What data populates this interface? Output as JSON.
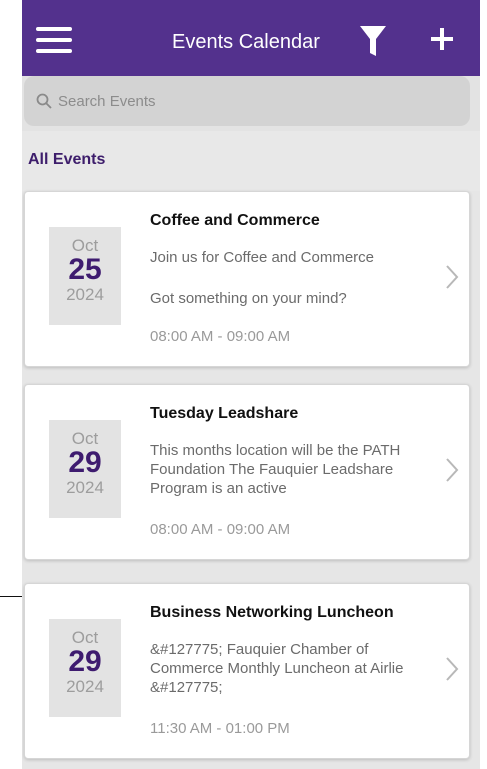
{
  "header": {
    "title": "Events Calendar",
    "menu_icon": "hamburger-menu-icon",
    "filter_icon": "filter-funnel-icon",
    "add_icon": "plus-icon"
  },
  "search": {
    "placeholder": "Search Events",
    "value": ""
  },
  "section": {
    "label": "All Events"
  },
  "colors": {
    "brand": "#53318d",
    "day_text": "#3e1b6f",
    "section_label": "#3d1d6b"
  },
  "events": [
    {
      "month": "Oct",
      "day": "25",
      "year": "2024",
      "title": "Coffee and Commerce",
      "description": "Join us for Coffee and Commerce",
      "description2": "Got something on your mind?",
      "time": "08:00 AM - 09:00 AM"
    },
    {
      "month": "Oct",
      "day": "29",
      "year": "2024",
      "title": "Tuesday Leadshare",
      "description": "This months location will be the PATH Foundation  The Fauquier Leadshare Program is an active",
      "time": "08:00 AM - 09:00 AM"
    },
    {
      "month": "Oct",
      "day": "29",
      "year": "2024",
      "title": "Business Networking Luncheon",
      "description": "&#127775; Fauquier Chamber of Commerce Monthly Luncheon at Airlie &#127775;",
      "time": "11:30 AM - 01:00 PM"
    }
  ]
}
